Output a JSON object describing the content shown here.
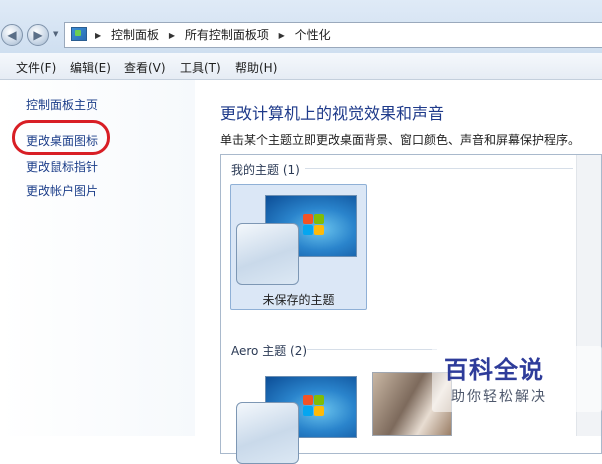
{
  "address_bar": {
    "breadcrumbs": [
      "控制面板",
      "所有控制面板项",
      "个性化"
    ]
  },
  "menu": {
    "items": [
      "文件(F)",
      "编辑(E)",
      "查看(V)",
      "工具(T)",
      "帮助(H)"
    ]
  },
  "sidebar": {
    "items": [
      "控制面板主页",
      "更改桌面图标",
      "更改鼠标指针",
      "更改帐户图片"
    ],
    "highlighted": "更改桌面图标",
    "highlight_color": "#d81e25"
  },
  "main": {
    "title": "更改计算机上的视觉效果和声音",
    "description": "单击某个主题立即更改桌面背景、窗口颜色、声音和屏幕保护程序。",
    "groups": [
      {
        "label": "我的主题 (1)",
        "themes": [
          "未保存的主题"
        ]
      },
      {
        "label": "Aero 主题 (2)",
        "themes": []
      }
    ]
  },
  "watermark": {
    "title": "百科全说",
    "subtitle": "助你轻松解决"
  },
  "icons": [
    "back-arrow-icon",
    "forward-arrow-icon",
    "control-panel-icon",
    "windows-logo-icon"
  ]
}
